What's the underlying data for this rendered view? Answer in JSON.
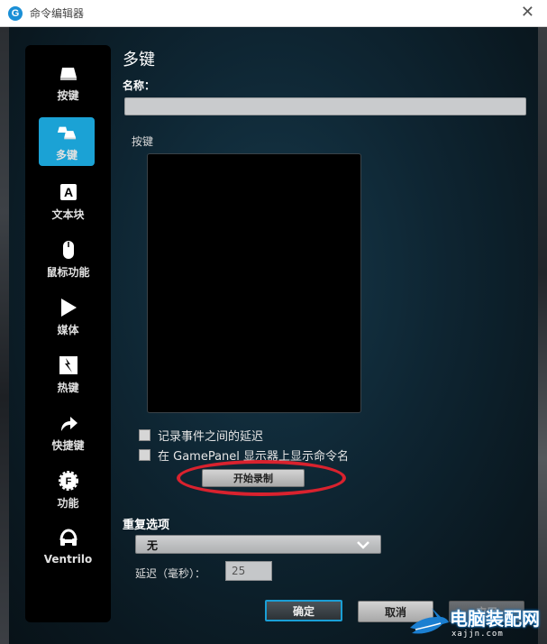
{
  "window": {
    "title": "命令编辑器",
    "logo_letter": "G"
  },
  "sidebar": {
    "items": [
      {
        "label": "按键"
      },
      {
        "label": "多键"
      },
      {
        "label": "文本块"
      },
      {
        "label": "鼠标功能"
      },
      {
        "label": "媒体"
      },
      {
        "label": "热键"
      },
      {
        "label": "快捷键"
      },
      {
        "label": "功能"
      },
      {
        "label": "Ventrilo"
      }
    ],
    "active_index": 1
  },
  "main": {
    "heading": "多键",
    "name_label": "名称：",
    "name_value": "",
    "keys_label": "按键",
    "record_delay_label": "记录事件之间的延迟",
    "record_delay_checked": false,
    "show_name_label": "在 GamePanel 显示器上显示命令名",
    "show_name_checked": false,
    "record_button": "开始录制",
    "repeat_label": "重复选项",
    "repeat_value": "无",
    "delay_label": "延迟（毫秒）：",
    "delay_value": "25"
  },
  "footer": {
    "ok": "确定",
    "cancel": "取消",
    "apply": "应用"
  },
  "watermark": {
    "text": "电脑装配网",
    "url": "www.dnzp.com",
    "sub": "xajjn.com"
  },
  "colors": {
    "accent": "#1ba2d5",
    "annotation": "#d9222e"
  }
}
